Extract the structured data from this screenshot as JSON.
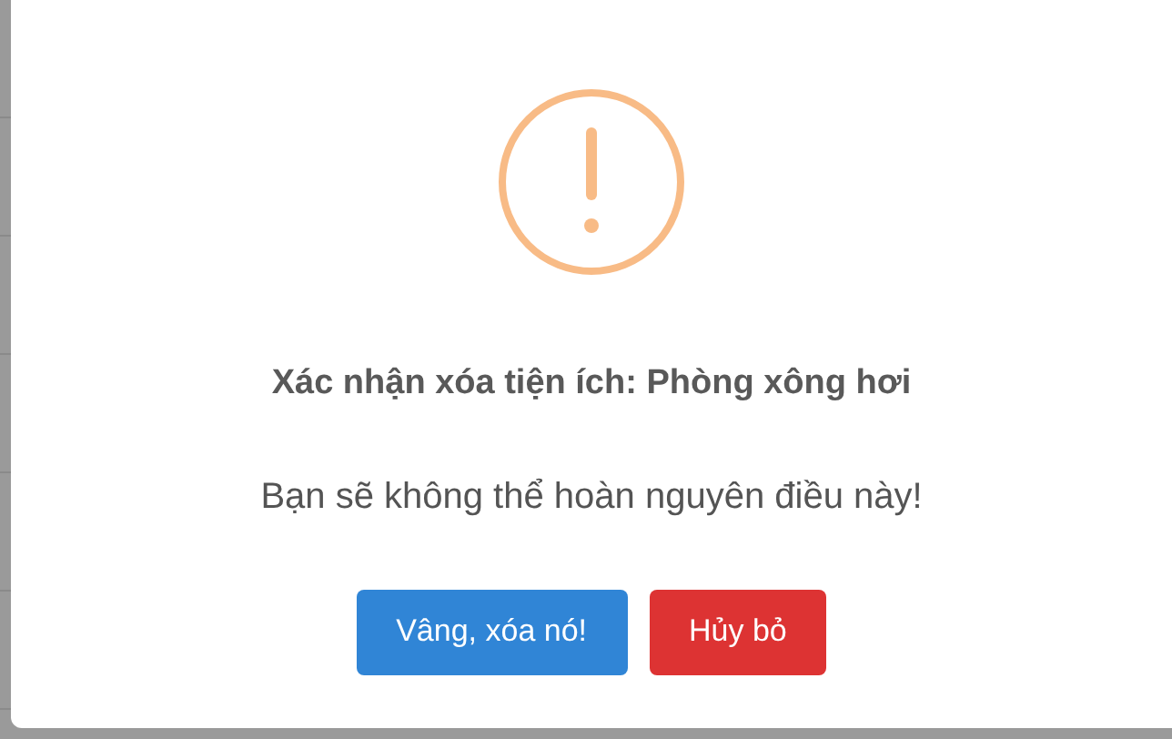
{
  "dialog": {
    "kind": "warning",
    "title": "Xác nhận xóa tiện ích: Phòng xông hơi",
    "message": "Bạn sẽ không thể hoàn nguyên điều này!",
    "buttons": [
      {
        "label": "Vâng, xóa nó!",
        "kind": "confirm"
      },
      {
        "label": "Hủy bỏ",
        "kind": "cancel"
      }
    ]
  }
}
